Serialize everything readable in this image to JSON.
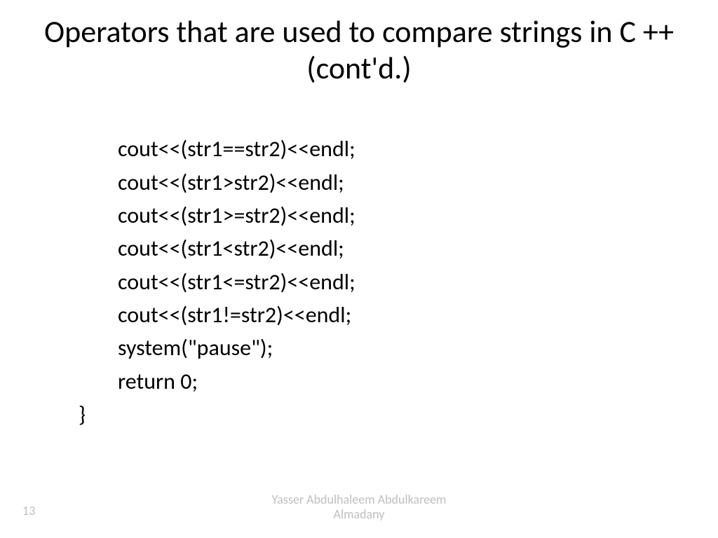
{
  "title": "Operators that are used to compare strings in C ++ (cont'd.)",
  "code": {
    "l1": "cout<<(str1==str2)<<endl;",
    "l2": "cout<<(str1>str2)<<endl;",
    "l3": "cout<<(str1>=str2)<<endl;",
    "l4": "cout<<(str1<str2)<<endl;",
    "l5": "cout<<(str1<=str2)<<endl;",
    "l6": "cout<<(str1!=str2)<<endl;",
    "l7": "system(\"pause\");",
    "l8": "return 0;",
    "l9": "}"
  },
  "footer": {
    "author_line1": "Yasser Abdulhaleem Abdulkareem",
    "author_line2": "Almadany"
  },
  "page_number": "13"
}
